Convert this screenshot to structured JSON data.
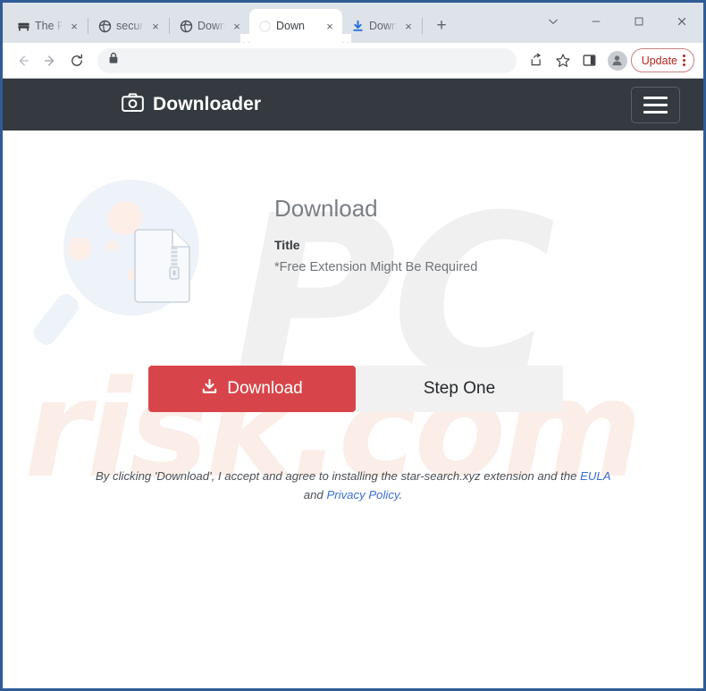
{
  "browser": {
    "tabs": [
      {
        "title": "The Pi",
        "favicon": "bench-icon",
        "active": false
      },
      {
        "title": "secure",
        "favicon": "globe-icon",
        "active": false
      },
      {
        "title": "Down",
        "favicon": "globe-icon",
        "active": false
      },
      {
        "title": "Down",
        "favicon": "spinner-icon",
        "active": true
      },
      {
        "title": "Down",
        "favicon": "download-arrow-icon",
        "active": false
      }
    ],
    "new_tab_label": "+",
    "close_label": "×",
    "window_controls": {
      "tab_search": "⌄",
      "minimize": "–",
      "maximize": "□",
      "close": "✕"
    },
    "toolbar": {
      "back": "←",
      "forward": "→",
      "reload": "↻",
      "url": "",
      "url_placeholder": "",
      "lock_icon": "lock-icon",
      "share_icon": "share-icon",
      "bookmark_icon": "star-icon",
      "sidepanel_icon": "side-panel-icon",
      "profile_icon": "profile-avatar-icon",
      "update_label": "Update",
      "menu_icon": "kebab-menu-icon"
    }
  },
  "site": {
    "header": {
      "logo_icon": "camera-icon",
      "brand": "Downloader",
      "menu_icon": "hamburger-icon"
    },
    "hero": {
      "title": "Download",
      "subtitle": "Title",
      "note": "*Free Extension Might Be Required",
      "art_icon": "zip-file-magnifier-illustration"
    },
    "actions": {
      "download_label": "Download",
      "download_icon": "download-tray-icon",
      "step_label": "Step One"
    },
    "disclaimer": {
      "part1": "By clicking 'Download', I accept and agree to installing the star-search.xyz extension and the",
      "eula_link": "EULA",
      "conjunction": "and",
      "privacy_link": "Privacy Policy",
      "period": "."
    },
    "watermark": {
      "top": "PC",
      "bottom": "risk.com"
    },
    "colors": {
      "accent_red": "#d7454a",
      "header_dark": "#343a40",
      "link_blue": "#3b6fd4",
      "panel_gray": "#f1f1f1",
      "window_border": "#2f5c96"
    }
  }
}
